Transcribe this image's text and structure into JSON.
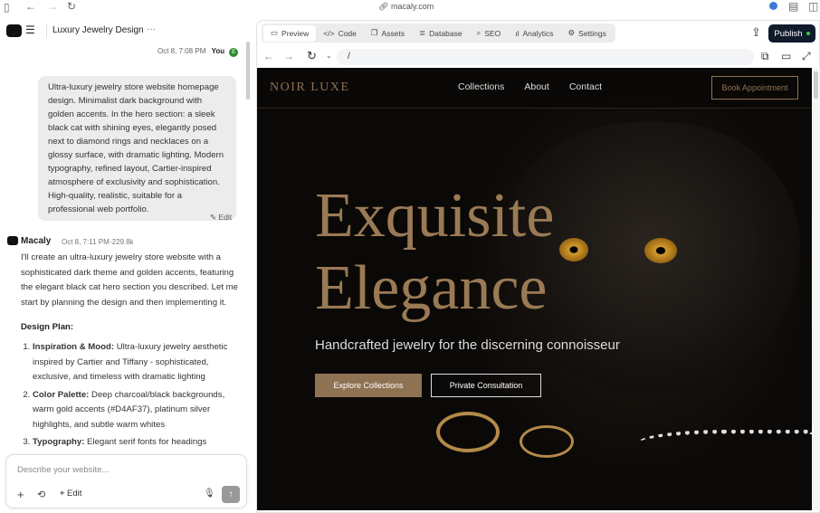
{
  "browser": {
    "url": "macaly.com"
  },
  "project": {
    "title": "Luxury Jewelry Design",
    "more": "···"
  },
  "user_msg": {
    "time": "Oct 8, 7:08 PM",
    "author": "You",
    "avatar": "E",
    "text": "Ultra-luxury jewelry store website homepage design. Minimalist dark background with golden accents. In the hero section: a sleek black cat with shining eyes, elegantly posed next to diamond rings and necklaces on a glossy surface, with dramatic lighting. Modern typography, refined layout, Cartier-inspired atmosphere of exclusivity and sophistication. High-quality, realistic, suitable for a professional web portfolio.",
    "edit": "Edit"
  },
  "ai_msg": {
    "author": "Macaly",
    "time": "Oct 8, 7:11 PM",
    "tokens": "-229.8k",
    "intro": "I'll create an ultra-luxury jewelry store website with a sophisticated dark theme and golden accents, featuring the elegant black cat hero section you described. Let me start by planning the design and then implementing it.",
    "plan_title": "Design Plan:",
    "plan": [
      {
        "label": "Inspiration & Mood:",
        "text": " Ultra-luxury jewelry aesthetic inspired by Cartier and Tiffany - sophisticated, exclusive, and timeless with dramatic lighting"
      },
      {
        "label": "Color Palette:",
        "text": " Deep charcoal/black backgrounds, warm gold accents (#D4AF37), platinum silver highlights, and subtle warm whites"
      },
      {
        "label": "Typography:",
        "text": " Elegant serif fonts for headings (luxury feel) and clean sans-serif for body text"
      }
    ]
  },
  "composer": {
    "placeholder": "Describe your website...",
    "edit": "Edit"
  },
  "toolbar": {
    "tabs": [
      "Preview",
      "Code",
      "Assets",
      "Database",
      "SEO",
      "Analytics",
      "Settings"
    ],
    "publish": "Publish"
  },
  "preview": {
    "path": "/"
  },
  "site": {
    "logo": "NOIR LUXE",
    "nav": [
      "Collections",
      "About",
      "Contact"
    ],
    "cta": "Book Appointment",
    "hero_line1": "Exquisite",
    "hero_line2": "Elegance",
    "subtitle": "Handcrafted jewelry for the discerning connoisseur",
    "btn_primary": "Explore Collections",
    "btn_secondary": "Private Consultation"
  },
  "colors": {
    "gold": "#8e7252",
    "publish_bg": "#0f1a2b",
    "green": "#2e8b2e"
  }
}
